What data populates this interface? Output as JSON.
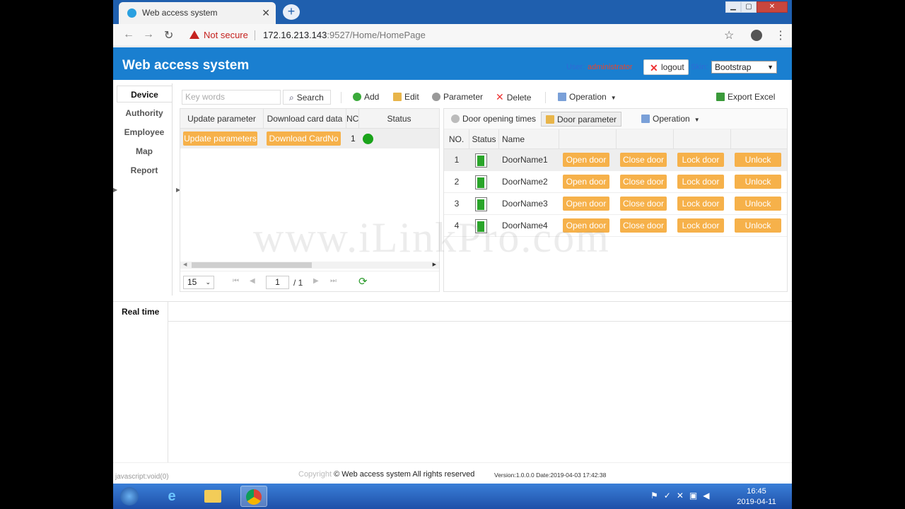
{
  "browser": {
    "tab_title": "Web access system",
    "new_tab": "+",
    "security": "Not secure",
    "url_host": "172.16.213.143",
    "url_rest": ":9527/Home/HomePage"
  },
  "app": {
    "title": "Web access system",
    "user_label": "User:",
    "user_name": "administrator",
    "logout": "logout",
    "skin_label": "Skin:",
    "skin_value": "Bootstrap"
  },
  "sidebar": {
    "items": [
      {
        "label": "Device"
      },
      {
        "label": "Authority"
      },
      {
        "label": "Employee"
      },
      {
        "label": "Map"
      },
      {
        "label": "Report"
      }
    ]
  },
  "toolbar": {
    "keywords_placeholder": "Key words",
    "search": "Search",
    "add": "Add",
    "edit": "Edit",
    "parameter": "Parameter",
    "delete": "Delete",
    "operation": "Operation",
    "export": "Export Excel"
  },
  "device_grid": {
    "headers": [
      "Update parameter",
      "Download card data",
      "NC",
      "Status"
    ],
    "rows": [
      {
        "update": "Update parameters",
        "download": "Download CardNo",
        "no": "1"
      }
    ],
    "page_size": "15",
    "page": "1",
    "page_total": "/ 1"
  },
  "door_panel": {
    "tabs": {
      "opening_times": "Door opening times",
      "door_parameter": "Door parameter",
      "operation": "Operation"
    },
    "headers": [
      "NO.",
      "Status",
      "Name"
    ],
    "actions": [
      "Open door",
      "Close door",
      "Lock door",
      "Unlock"
    ],
    "doors": [
      {
        "no": "1",
        "name": "DoorName1"
      },
      {
        "no": "2",
        "name": "DoorName2"
      },
      {
        "no": "3",
        "name": "DoorName3"
      },
      {
        "no": "4",
        "name": "DoorName4"
      }
    ]
  },
  "watermark": "www.iLinkPro.com",
  "realtime": {
    "tab": "Real time"
  },
  "footer": {
    "status": "javascript:void(0)",
    "copyright": "Copyright",
    "copyright_main": "© Web access system All rights reserved",
    "version": "Version:1.0.0.0 Date:2019-04-03 17:42:38"
  },
  "taskbar": {
    "time": "16:45",
    "date": "2019-04-11"
  },
  "colors": {
    "header": "#1a7fd0",
    "action": "#f6b14a",
    "online": "#1aa31a",
    "door": "#2aa52a"
  }
}
